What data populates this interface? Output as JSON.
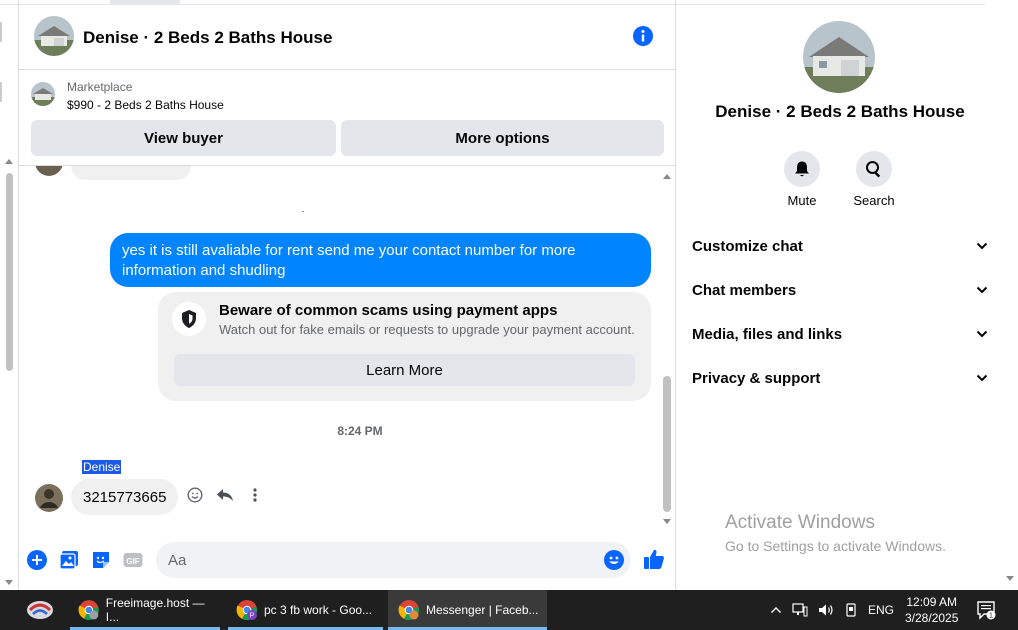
{
  "chat": {
    "title": "Denise · 2 Beds 2 Baths House",
    "listing": {
      "category": "Marketplace",
      "price_title": "$990 - 2 Beds 2 Baths House"
    },
    "buttons": {
      "view_buyer": "View buyer",
      "more_options": "More options"
    },
    "outgoing_message": "yes it is still avaliable for rent send me your contact number for more information and shudling",
    "scam_notice": {
      "title": "Beware of common scams using payment apps",
      "subtitle": "Watch out for fake emails or requests to upgrade your payment account.",
      "button": "Learn More"
    },
    "timestamp": "8:24 PM",
    "sender_name": "Denise",
    "incoming_message": "3215773665",
    "composer_placeholder": "Aa"
  },
  "side_panel": {
    "title": "Denise · 2 Beds 2 Baths House",
    "actions": [
      "Mute",
      "Search"
    ],
    "sections": [
      "Customize chat",
      "Chat members",
      "Media, files and links",
      "Privacy & support"
    ]
  },
  "watermark": {
    "line1": "Activate Windows",
    "line2": "Go to Settings to activate Windows."
  },
  "taskbar": {
    "items": [
      {
        "label": "Freeimage.host — I...",
        "badge": ""
      },
      {
        "label": "pc 3 fb work - Goo...",
        "badge": "P"
      },
      {
        "label": "Messenger | Faceb...",
        "badge": ""
      }
    ],
    "language": "ENG",
    "time": "12:09 AM",
    "date": "3/28/2025",
    "notifications": "1"
  },
  "colors": {
    "accent": "#0084ff",
    "info_blue": "#0866ff",
    "taskbar": "#1f1f1f"
  }
}
